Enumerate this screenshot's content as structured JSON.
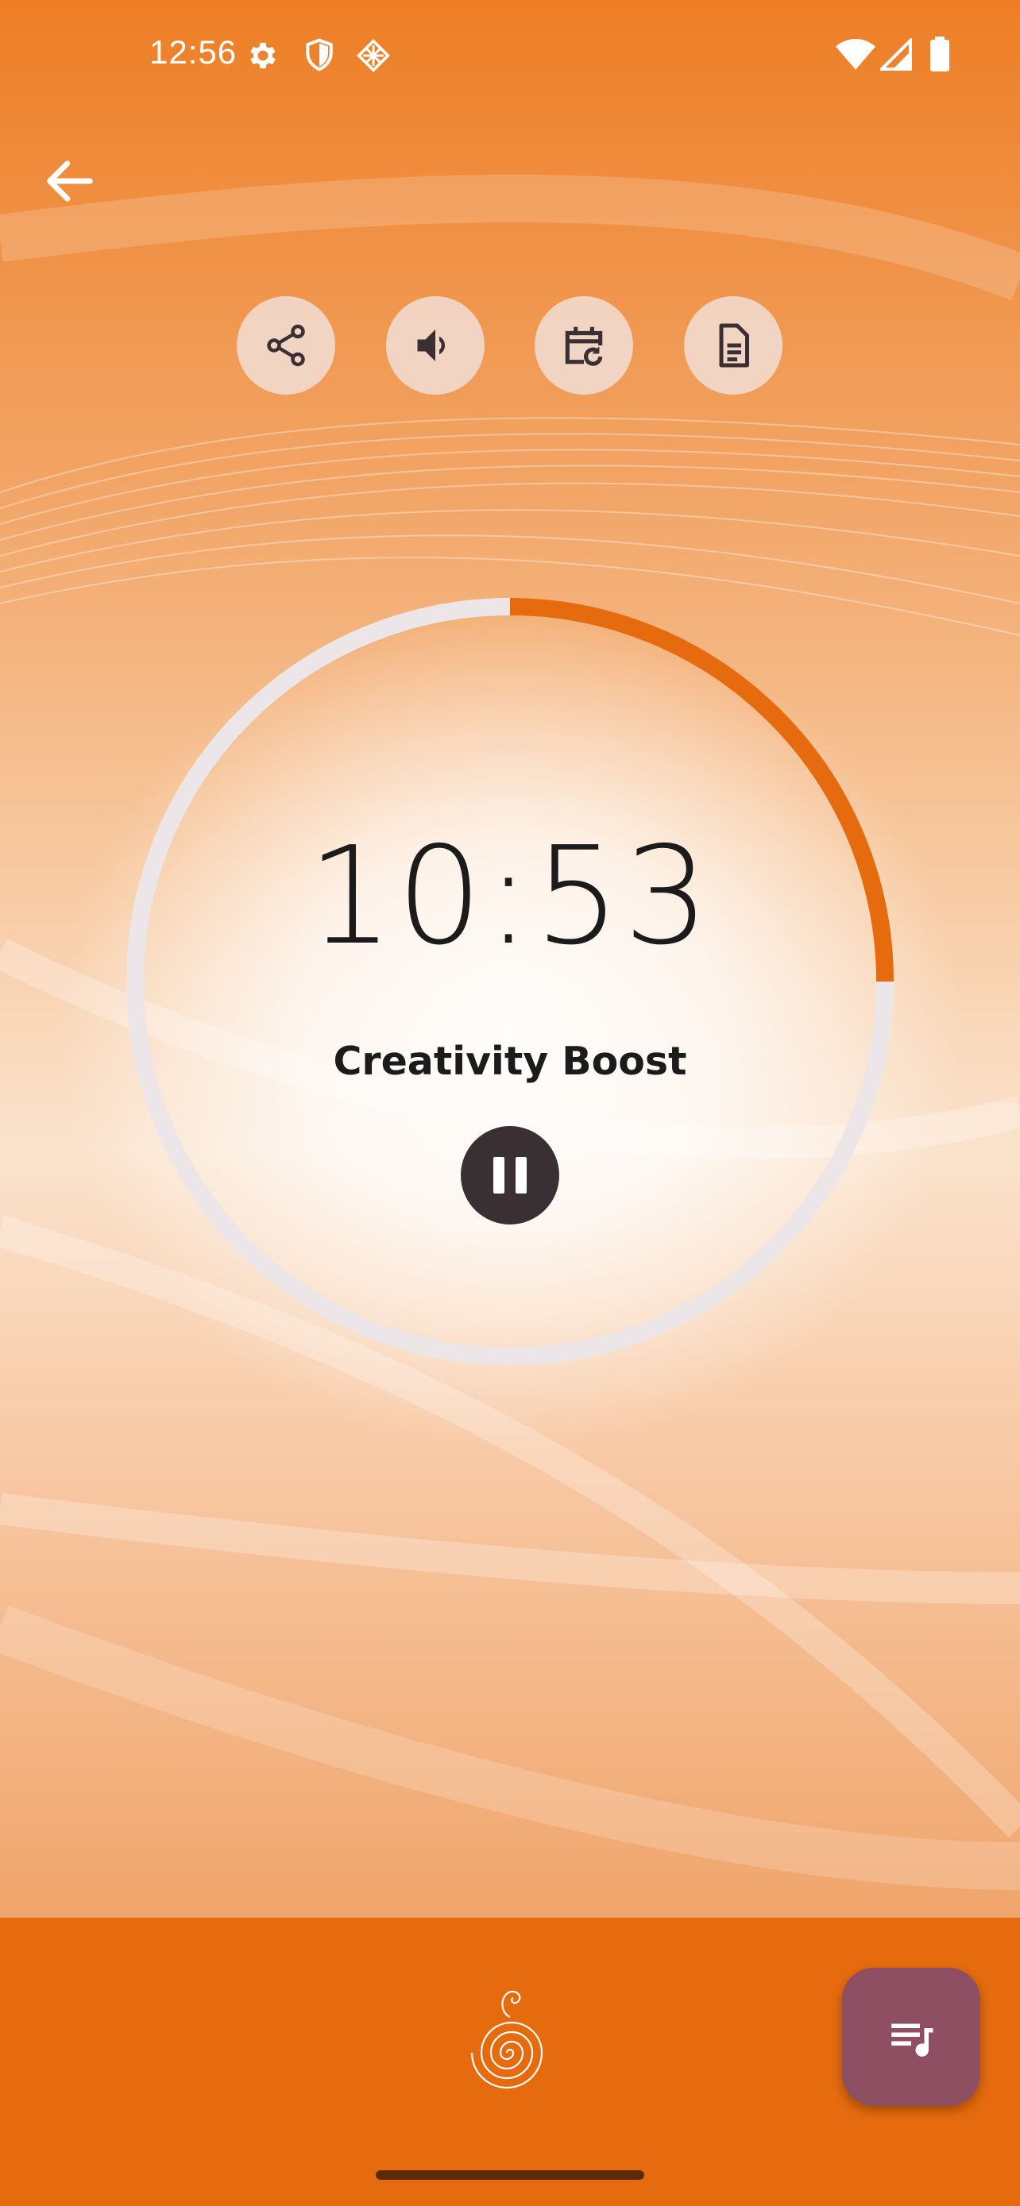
{
  "status_bar": {
    "time": "12:56",
    "left_icons": [
      "gear-icon",
      "shield-icon",
      "diamond-grid-icon"
    ],
    "right_icons": [
      "wifi-icon",
      "signal-icon",
      "battery-icon"
    ]
  },
  "nav": {
    "back_icon": "arrow-left-icon"
  },
  "actions": [
    {
      "name": "share",
      "icon": "share-icon"
    },
    {
      "name": "volume",
      "icon": "volume-icon"
    },
    {
      "name": "schedule",
      "icon": "calendar-repeat-icon"
    },
    {
      "name": "notes",
      "icon": "document-icon"
    }
  ],
  "player": {
    "time_remaining": "10:53",
    "progress_fraction": 0.25,
    "title": "Creativity Boost",
    "state": "playing",
    "pause_icon": "pause-icon"
  },
  "bottom": {
    "logo_icon": "spiral-logo-icon",
    "fab_icon": "playlist-music-icon"
  },
  "colors": {
    "accent": "#E66B0E",
    "ring_track": "#EDE6E8",
    "pause_button": "#3A2F33",
    "fab": "#8E4F63"
  }
}
